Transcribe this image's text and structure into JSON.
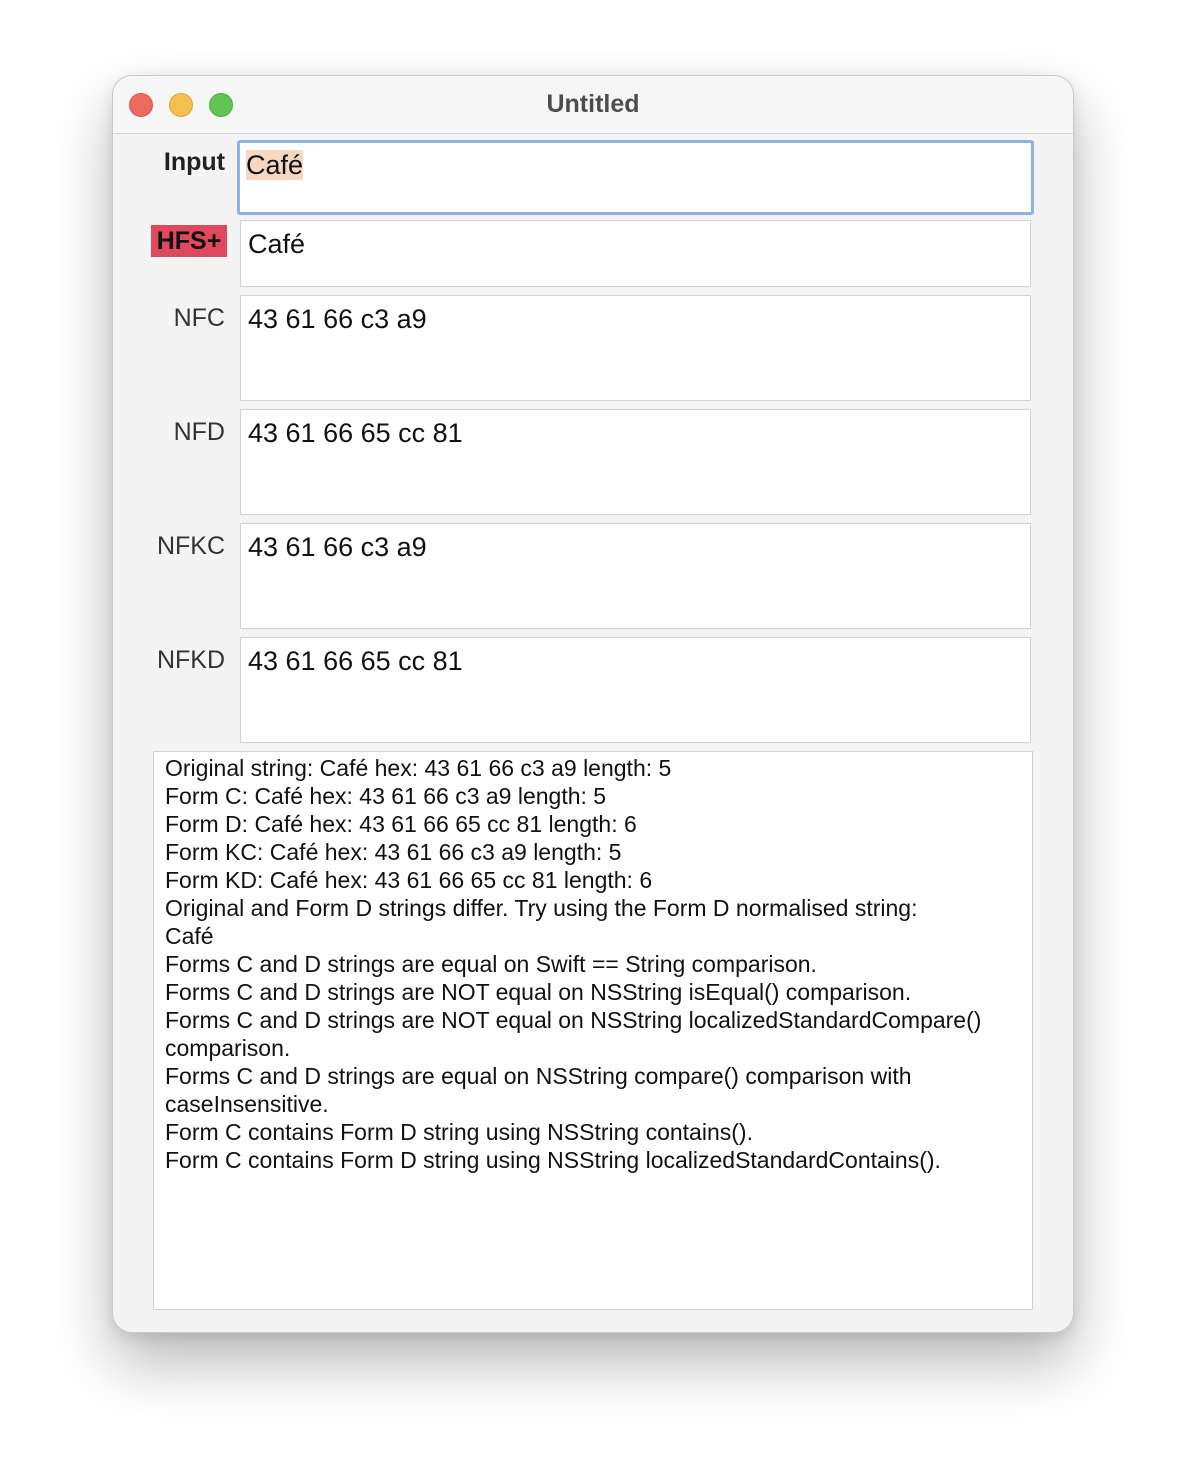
{
  "window": {
    "title": "Untitled"
  },
  "rows": {
    "input": {
      "label": "Input",
      "value": "Café"
    },
    "hfs": {
      "label": "HFS+",
      "value": "Café"
    },
    "nfc": {
      "label": "NFC",
      "value": "43 61 66 c3 a9"
    },
    "nfd": {
      "label": "NFD",
      "value": "43 61 66 65 cc 81"
    },
    "nfkc": {
      "label": "NFKC",
      "value": "43 61 66 c3 a9"
    },
    "nfkd": {
      "label": "NFKD",
      "value": "43 61 66 65 cc 81"
    }
  },
  "log": {
    "lines": [
      "Original string: Café hex: 43 61 66 c3 a9 length: 5",
      "Form C: Café hex: 43 61 66 c3 a9 length: 5",
      "Form D: Café hex: 43 61 66 65 cc 81 length: 6",
      "Form KC: Café hex: 43 61 66 c3 a9 length: 5",
      "Form KD: Café hex: 43 61 66 65 cc 81 length: 6",
      "Original and Form D strings differ. Try using the Form D normalised string:",
      "Café",
      "Forms C and D strings are equal on Swift == String comparison.",
      "Forms C and D strings are NOT equal on NSString isEqual() comparison.",
      "Forms C and D strings are NOT equal on NSString localizedStandardCompare() comparison.",
      "Forms C and D strings are equal on NSString compare() comparison with caseInsensitive.",
      "Form C contains Form D string using NSString contains().",
      "Form C contains Form D string using NSString localizedStandardContains()."
    ]
  },
  "colors": {
    "hfs_badge": "#e0485f",
    "focus_ring": "#8fb1ea",
    "selection": "#f6d7c0"
  }
}
